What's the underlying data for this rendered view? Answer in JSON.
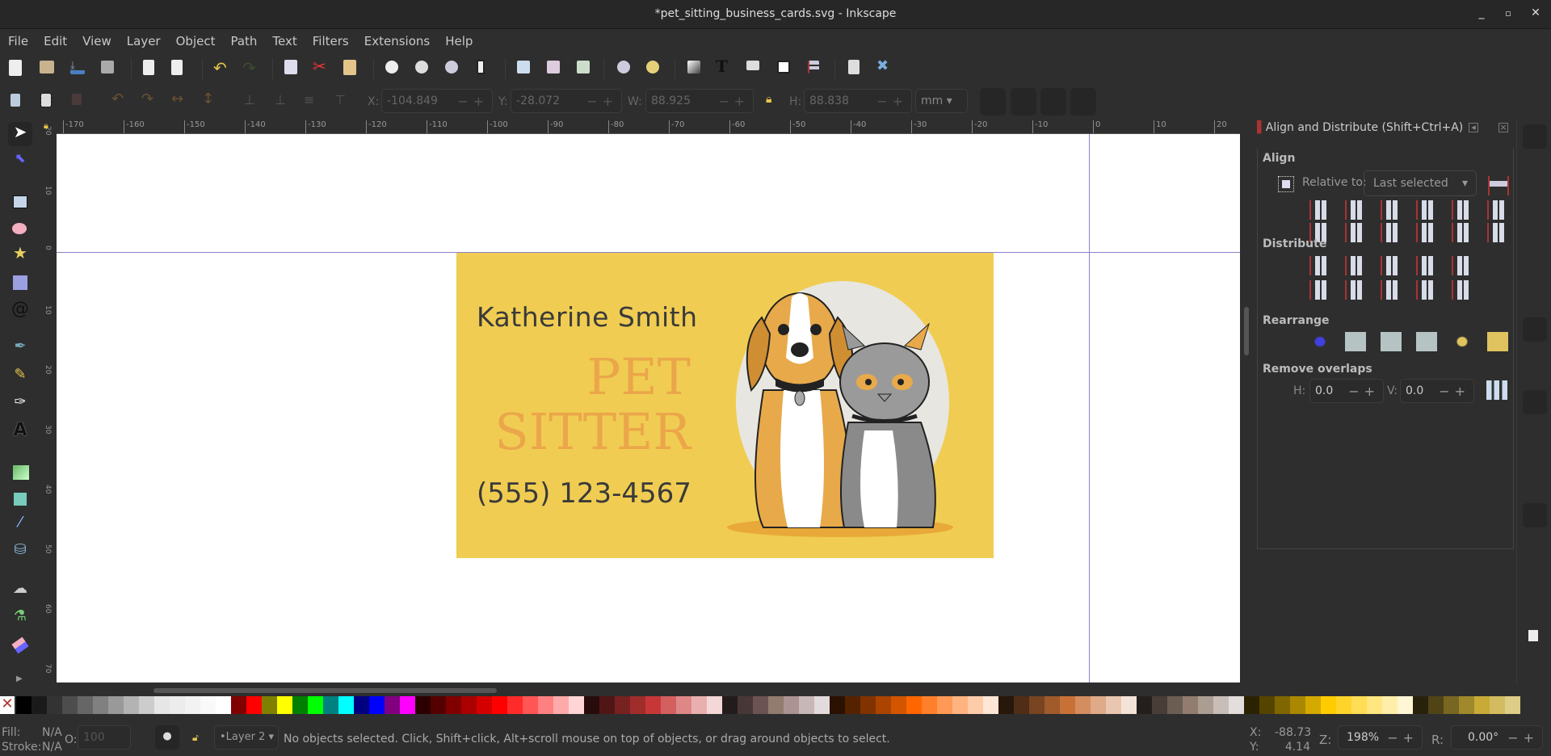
{
  "window": {
    "title": "*pet_sitting_business_cards.svg - Inkscape",
    "controls": [
      "minimize",
      "maximize",
      "close"
    ]
  },
  "menu": [
    "File",
    "Edit",
    "View",
    "Layer",
    "Object",
    "Path",
    "Text",
    "Filters",
    "Extensions",
    "Help"
  ],
  "commands_bar": [
    "new-document-icon",
    "open-icon",
    "save-icon",
    "print-icon",
    "import-icon",
    "export-icon",
    "undo-icon",
    "redo-icon",
    "copy-icon",
    "cut-icon",
    "paste-icon",
    "zoom-selection-icon",
    "zoom-drawing-icon",
    "zoom-page-icon",
    "zoom-page-width-icon",
    "duplicate-icon",
    "clone-icon",
    "unlink-clone-icon",
    "group-icon",
    "ungroup-icon",
    "fill-stroke-icon",
    "text-font-icon",
    "layers-icon",
    "xml-editor-icon",
    "align-distribute-icon",
    "document-properties-icon",
    "preferences-icon"
  ],
  "tool_controls": {
    "x_label": "X:",
    "x_value": "-104.849",
    "y_label": "Y:",
    "y_value": "-28.072",
    "w_label": "W:",
    "w_value": "88.925",
    "h_label": "H:",
    "h_value": "88.838",
    "unit": "mm"
  },
  "toolbox": [
    "selector",
    "node",
    "rectangle",
    "ellipse",
    "star",
    "3d-box",
    "spiral",
    "bezier",
    "pencil",
    "calligraphy",
    "text",
    "gradient",
    "mesh",
    "dropper",
    "paint-bucket",
    "tweak",
    "spray",
    "eraser"
  ],
  "ruler_top": [
    "-170",
    "-160",
    "-150",
    "-140",
    "-130",
    "-120",
    "-110",
    "-100",
    "-90",
    "-80",
    "-70",
    "-60",
    "-50",
    "-40",
    "-30",
    "-20",
    "-10",
    "0",
    "10",
    "20"
  ],
  "ruler_left": [
    "20",
    "10",
    "0",
    "10",
    "20",
    "30",
    "40",
    "50",
    "60",
    "70"
  ],
  "card": {
    "name": "Katherine Smith",
    "title_line1": "PET",
    "title_line2": "SITTER",
    "phone": "(555) 123-4567",
    "background": "#f0cd52",
    "accent": "#eba64a"
  },
  "align_panel": {
    "header": "Align and Distribute (Shift+Ctrl+A)",
    "align_label": "Align",
    "relative_label": "Relative to:",
    "relative_value": "Last selected",
    "distribute_label": "Distribute",
    "rearrange_label": "Rearrange",
    "overlaps_label": "Remove overlaps",
    "h_label": "H:",
    "h_value": "0.0",
    "v_label": "V:",
    "v_value": "0.0"
  },
  "status": {
    "fill_label": "Fill:",
    "fill_value": "N/A",
    "stroke_label": "Stroke:",
    "stroke_value": "N/A",
    "opacity_label": "O:",
    "opacity_value": "100",
    "layer": "•Layer 2",
    "message": "No objects selected. Click, Shift+click, Alt+scroll mouse on top of objects, or drag around objects to select.",
    "cursor_x_label": "X:",
    "cursor_x": "-88.73",
    "cursor_y_label": "Y:",
    "cursor_y": "4.14",
    "zoom_label": "Z:",
    "zoom": "198%",
    "rotation_label": "R:",
    "rotation": "0.00°"
  },
  "palette": [
    "#000000",
    "#1a1a1a",
    "#333333",
    "#4d4d4d",
    "#666666",
    "#808080",
    "#999999",
    "#b3b3b3",
    "#cccccc",
    "#e6e6e6",
    "#ececec",
    "#f2f2f2",
    "#f9f9f9",
    "#ffffff",
    "#800000",
    "#ff0000",
    "#808000",
    "#ffff00",
    "#008000",
    "#00ff00",
    "#008080",
    "#00ffff",
    "#000080",
    "#0000ff",
    "#800080",
    "#ff00ff",
    "#2b0000",
    "#550000",
    "#800000",
    "#aa0000",
    "#d40000",
    "#ff0000",
    "#ff2a2a",
    "#ff5555",
    "#ff8080",
    "#ffaaaa",
    "#ffd5d5",
    "#280b0b",
    "#501616",
    "#782121",
    "#a02c2c",
    "#c83737",
    "#d35f5f",
    "#de8787",
    "#e9afaf",
    "#f4d7d7",
    "#241c1c",
    "#483737",
    "#6c5353",
    "#917c6f",
    "#ac9393",
    "#c8b7b7",
    "#e3dbdb",
    "#2b1100",
    "#552200",
    "#803300",
    "#aa4400",
    "#d45500",
    "#ff6600",
    "#ff7f2a",
    "#ff9955",
    "#ffb380",
    "#ffccaa",
    "#ffe6d5",
    "#28170b",
    "#502d16",
    "#784421",
    "#a05a2c",
    "#c87137",
    "#d38d5f",
    "#deaa87",
    "#e9c6af",
    "#f4e3d7",
    "#241f1c",
    "#483e37",
    "#6c5d53",
    "#917c6f",
    "#ac9d93",
    "#c8beb7",
    "#e3dedb",
    "#2b2200",
    "#554400",
    "#806600",
    "#aa8800",
    "#d4aa00",
    "#ffcc00",
    "#ffd42a",
    "#ffdd55",
    "#ffe680",
    "#ffeeaa",
    "#fff6d5",
    "#28220b",
    "#504416",
    "#786721",
    "#a0892c",
    "#c8ab37",
    "#d3bc5f",
    "#decd87"
  ]
}
